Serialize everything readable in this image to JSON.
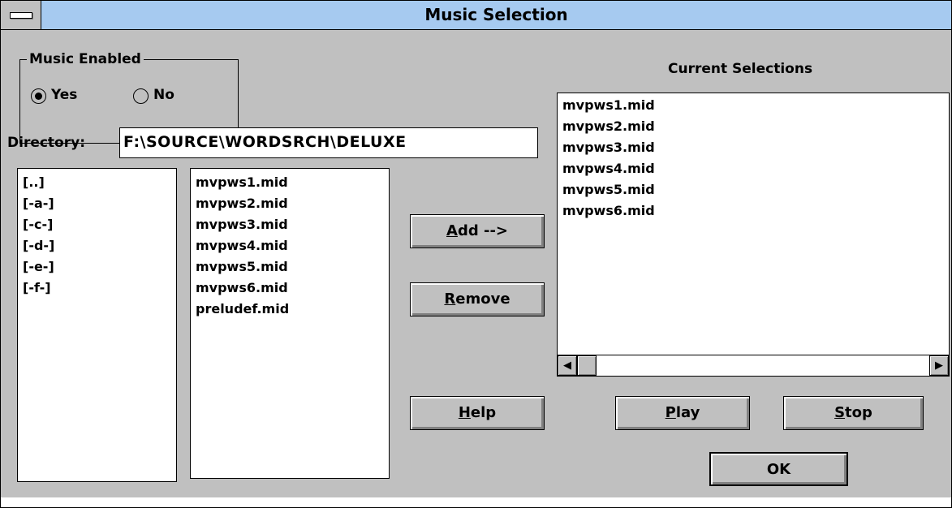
{
  "window": {
    "title": "Music Selection"
  },
  "music_enabled": {
    "group_label": "Music Enabled",
    "options": [
      {
        "label": "Yes",
        "selected": true
      },
      {
        "label": "No",
        "selected": false
      }
    ]
  },
  "directory": {
    "label": "Directory:",
    "value": "F:\\SOURCE\\WORDSRCH\\DELUXE"
  },
  "dir_list": {
    "items": [
      "[..]",
      "[-a-]",
      "[-c-]",
      "[-d-]",
      "[-e-]",
      "[-f-]"
    ]
  },
  "file_list": {
    "items": [
      "mvpws1.mid",
      "mvpws2.mid",
      "mvpws3.mid",
      "mvpws4.mid",
      "mvpws5.mid",
      "mvpws6.mid",
      "preludef.mid"
    ]
  },
  "current": {
    "heading": "Current Selections",
    "items": [
      "mvpws1.mid",
      "mvpws2.mid",
      "mvpws3.mid",
      "mvpws4.mid",
      "mvpws5.mid",
      "mvpws6.mid"
    ]
  },
  "buttons": {
    "add": {
      "mnemonic": "A",
      "rest": "dd -->"
    },
    "remove": {
      "mnemonic": "R",
      "rest": "emove"
    },
    "help": {
      "mnemonic": "H",
      "rest": "elp"
    },
    "play": {
      "mnemonic": "P",
      "rest": "lay"
    },
    "stop": {
      "mnemonic": "S",
      "rest": "top"
    },
    "ok": {
      "label": "OK"
    }
  },
  "icons": {
    "system_menu": "system-menu-icon",
    "scroll_left": "arrow-left-icon",
    "scroll_right": "arrow-right-icon"
  }
}
